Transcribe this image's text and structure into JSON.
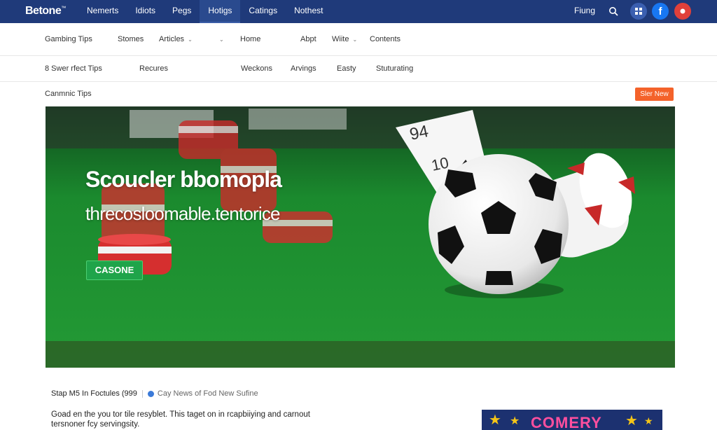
{
  "brand": {
    "name": "Betone",
    "mark": "™"
  },
  "topnav": {
    "items": [
      "Nemerts",
      "Idiots",
      "Pegs",
      "Hotigs",
      "Catings",
      "Nothest"
    ],
    "active_index": 3
  },
  "header_right": {
    "signin": "Fiung"
  },
  "icons": {
    "search": "search-icon",
    "grid": "grid-icon",
    "facebook": "facebook-icon",
    "red": "profile-icon"
  },
  "nav_row1": {
    "gambling_tips": "Gambing Tips",
    "stories": "Stomes",
    "articles": "Articles",
    "home": "Home",
    "about": "Abpt",
    "write": "Wiite",
    "contents": "Contents"
  },
  "nav_row2": {
    "perfect_tips": "8 Swer rfect Tips",
    "recures": "Recures",
    "weekons": "Weckons",
    "arvings": "Arvings",
    "easty": "Easty",
    "stuturating": "Stuturating"
  },
  "section": {
    "label": "Canmnic Tips",
    "cta": "Sler New"
  },
  "hero": {
    "title": "Scoucler bbomopla",
    "subtitle": "threcosloomable.tentorice",
    "button": "CASONE",
    "card_texts": [
      "94",
      "10"
    ]
  },
  "article": {
    "byline": "Stap M5 In Foctules (999",
    "source": "Cay News of Fod New Sufine",
    "excerpt": "Goad en the you tor tile resyblet. This taget on in rcapbiiying and carnout tersnoner fcy servingsity."
  },
  "promo": {
    "text": "COMERY"
  },
  "colors": {
    "topbar": "#1f3a7a",
    "cta": "#f4622a",
    "hero_button": "#1fa44a",
    "felt": "#1e8f2e"
  }
}
